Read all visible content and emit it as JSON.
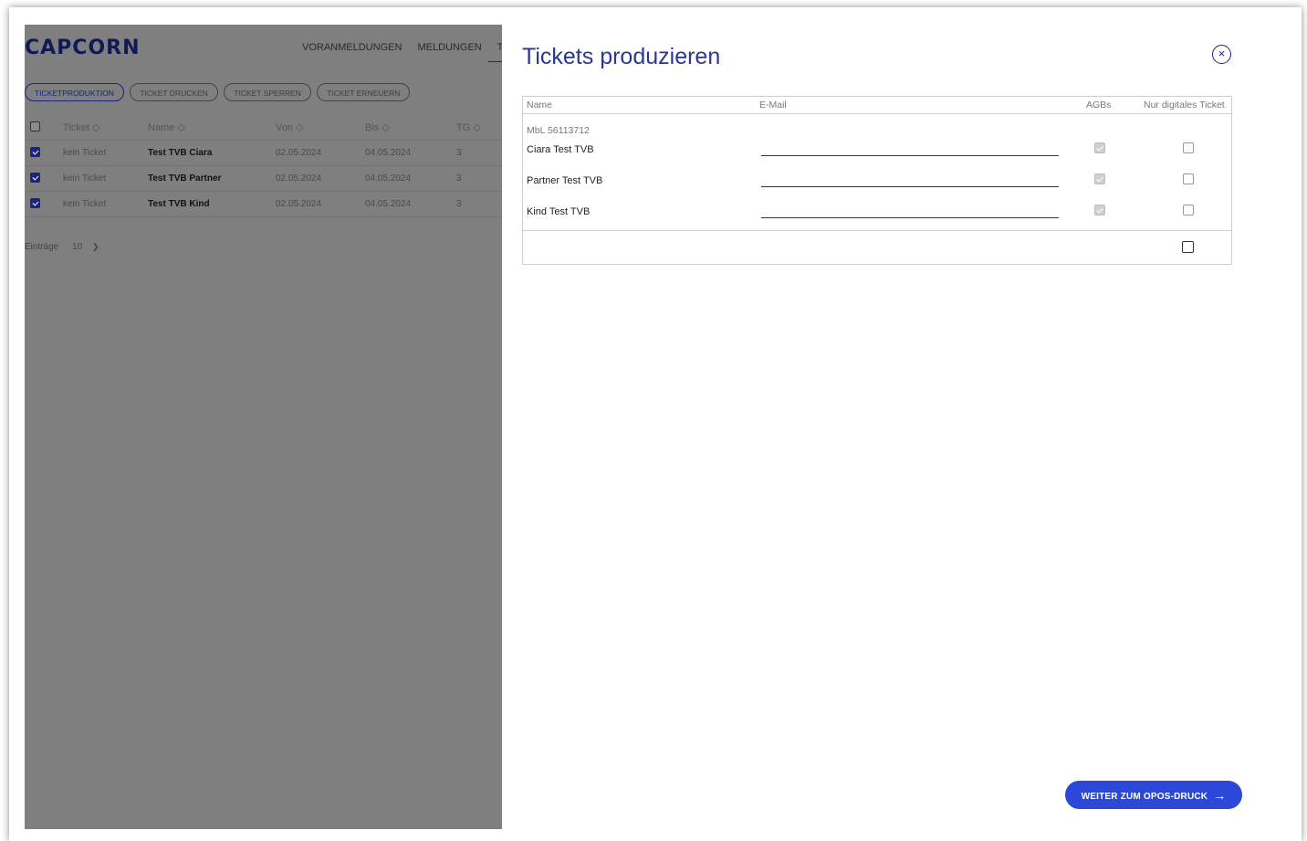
{
  "app": {
    "logo": "CAPCORN",
    "nav": [
      "VORANMELDUNGEN",
      "MELDUNGEN",
      "T"
    ],
    "pills": [
      {
        "label": "TICKETPRODUKTION",
        "active": true
      },
      {
        "label": "TICKET DRUCKEN",
        "active": false
      },
      {
        "label": "TICKET SPERREN",
        "active": false
      },
      {
        "label": "TICKET ERNEUERN",
        "active": false
      }
    ],
    "table": {
      "headers": {
        "ticket": "Ticket ◇",
        "name": "Name ◇",
        "von": "Von ◇",
        "bis": "Bis ◇",
        "tg": "TG ◇"
      },
      "rows": [
        {
          "ticket": "kein Ticket",
          "name": "Test TVB Ciara",
          "von": "02.05.2024",
          "bis": "04.05.2024",
          "tg": "3",
          "checked": true
        },
        {
          "ticket": "kein Ticket",
          "name": "Test TVB Partner",
          "von": "02.05.2024",
          "bis": "04.05.2024",
          "tg": "3",
          "checked": true
        },
        {
          "ticket": "kein Ticket",
          "name": "Test TVB Kind",
          "von": "02.05.2024",
          "bis": "04.05.2024",
          "tg": "3",
          "checked": true
        }
      ]
    },
    "entries_label": "Einträge",
    "entries_value": "10"
  },
  "panel": {
    "title": "Tickets produzieren",
    "columns": {
      "name": "Name",
      "email": "E-Mail",
      "agb": "AGBs",
      "digital": "Nur digitales Ticket"
    },
    "group_label": "MbL 56113712",
    "persons": [
      {
        "name": "Ciara Test TVB",
        "email": "",
        "agb": true,
        "digital": false
      },
      {
        "name": "Partner Test TVB",
        "email": "",
        "agb": true,
        "digital": false
      },
      {
        "name": "Kind Test TVB",
        "email": "",
        "agb": true,
        "digital": false
      }
    ],
    "next_button": "WEITER ZUM OPOS-DRUCK",
    "next_arrow": "→",
    "close_icon": "×"
  },
  "colors": {
    "accent": "#1a237e",
    "button": "#2b48d8",
    "title": "#2a3795",
    "overlay": "#7f7f7f"
  }
}
